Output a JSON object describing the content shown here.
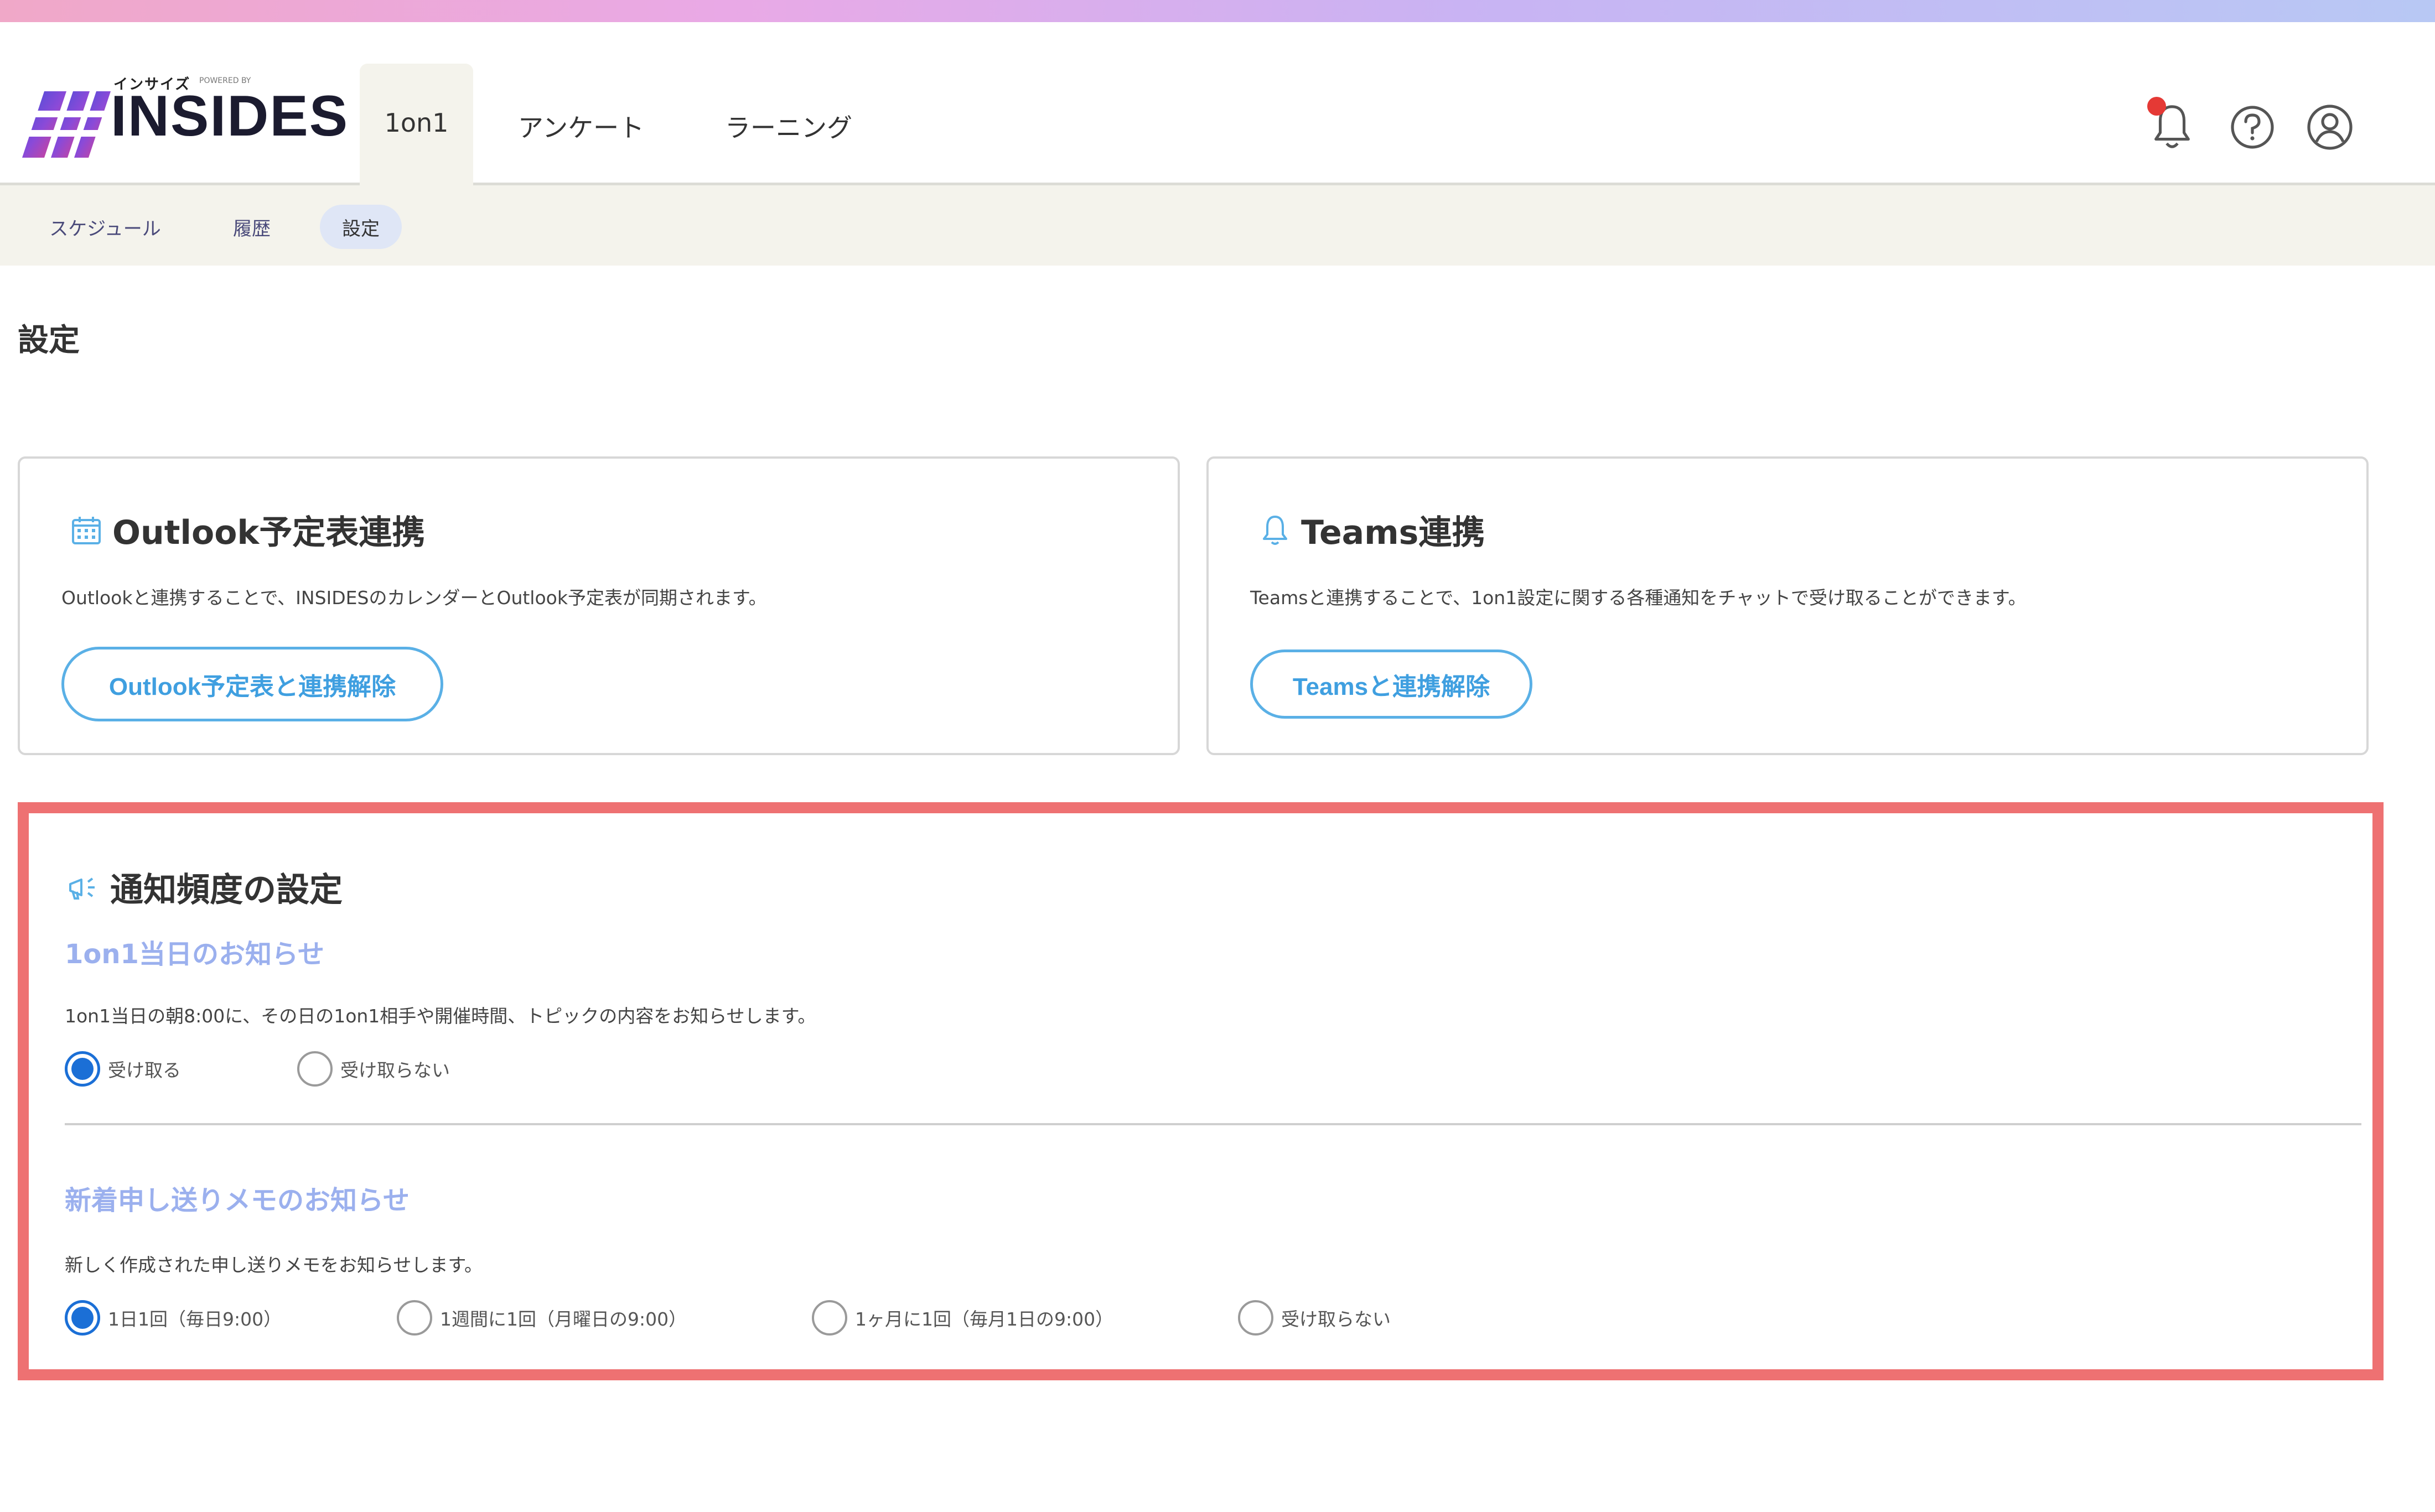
{
  "colors": {
    "accent": "#3f9fe0",
    "selected_radio": "#1b6fd6",
    "section_title": "#9bb0ee",
    "highlight_border": "#ee7172",
    "subnav_bg": "#f4f3ec",
    "notification_dot": "#e53935"
  },
  "logo": {
    "wordmark": "INSIDES",
    "kana": "インサイズ",
    "powered": "POWERED BY"
  },
  "header": {
    "tabs": [
      {
        "label": "1on1",
        "active": true
      },
      {
        "label": "アンケート",
        "active": false
      },
      {
        "label": "ラーニング",
        "active": false
      }
    ],
    "icons": [
      "bell-icon",
      "help-icon",
      "user-icon"
    ]
  },
  "subnav": {
    "items": [
      {
        "label": "スケジュール",
        "active": false
      },
      {
        "label": "履歴",
        "active": false
      },
      {
        "label": "設定",
        "active": true
      }
    ]
  },
  "page": {
    "title": "設定"
  },
  "outlook": {
    "title": "Outlook予定表連携",
    "description": "Outlookと連携することで、INSIDESのカレンダーとOutlook予定表が同期されます。",
    "button": "Outlook予定表と連携解除"
  },
  "teams": {
    "title": "Teams連携",
    "description": "Teamsと連携することで、1on1設定に関する各種通知をチャットで受け取ることができます。",
    "button": "Teamsと連携解除"
  },
  "notify": {
    "title": "通知頻度の設定",
    "day_of": {
      "title": "1on1当日のお知らせ",
      "description": "1on1当日の朝8:00に、その日の1on1相手や開催時間、トピックの内容をお知らせします。",
      "options": [
        {
          "label": "受け取る",
          "checked": true
        },
        {
          "label": "受け取らない",
          "checked": false
        }
      ]
    },
    "memo": {
      "title": "新着申し送りメモのお知らせ",
      "description": "新しく作成された申し送りメモをお知らせします。",
      "options": [
        {
          "label": "1日1回（毎日9:00）",
          "checked": true
        },
        {
          "label": "1週間に1回（月曜日の9:00）",
          "checked": false
        },
        {
          "label": "1ヶ月に1回（毎月1日の9:00）",
          "checked": false
        },
        {
          "label": "受け取らない",
          "checked": false
        }
      ]
    }
  }
}
